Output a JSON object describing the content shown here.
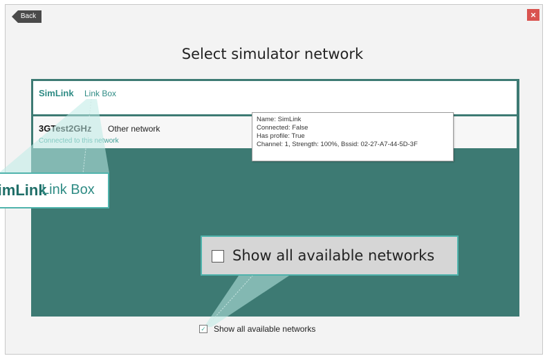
{
  "header": {
    "back_label": "Back",
    "close_label": "×"
  },
  "page_title": "Select simulator network",
  "networks": [
    {
      "name": "SimLink",
      "description": "Link Box",
      "status": ""
    },
    {
      "name": "3GTest2GHz",
      "description": "Other network",
      "status": "Connected to this network"
    }
  ],
  "tooltip": {
    "lines": [
      "Name: SimLink",
      "Connected: False",
      "Has profile: True",
      "Channel: 1, Strength: 100%, Bssid: 02-27-A7-44-5D-3F"
    ]
  },
  "callouts": {
    "network_name": "SimLink",
    "network_desc": "Link Box",
    "checkbox_label": "Show all available networks"
  },
  "show_all": {
    "label": "Show all available networks",
    "checked": true
  },
  "colors": {
    "panel": "#3d7a73",
    "accent": "#2e8b84",
    "callout_border": "#4fb3ac",
    "close": "#d9534f"
  }
}
